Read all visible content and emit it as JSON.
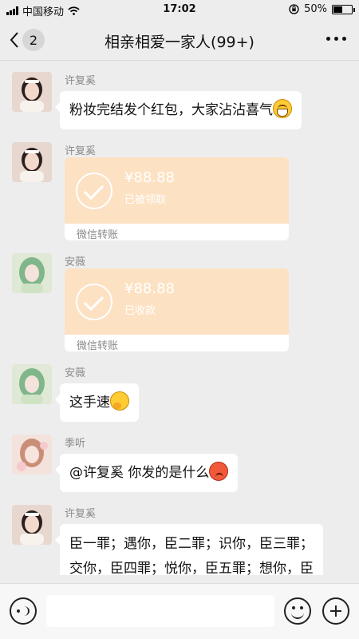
{
  "status_bar": {
    "carrier": "中国移动",
    "time": "17:02",
    "battery_percent": "50%",
    "battery_level": 0.5,
    "icons": [
      "signal-icon",
      "wifi-icon",
      "orientation-lock-icon",
      "battery-icon"
    ]
  },
  "header": {
    "back_count": "2",
    "title": "相亲相爱一家人(99+)",
    "icons": [
      "chevron-left-icon",
      "more-icon"
    ]
  },
  "messages": [
    {
      "sender": "许复奚",
      "text": "粉妆完结发个红包，大家沾沾喜气",
      "emoji": "grin-emoji"
    },
    {
      "sender": "许复奚",
      "type": "transfer",
      "amount": "¥88.88",
      "status": "已被领取",
      "label": "微信转账"
    },
    {
      "sender": "安薇",
      "type": "transfer",
      "amount": "¥88.88",
      "status": "已收款",
      "label": "微信转账"
    },
    {
      "sender": "安薇",
      "text": "这手速",
      "emoji": "thinking-emoji"
    },
    {
      "sender": "季听",
      "text": "@许复奚 你发的是什么",
      "emoji": "angry-emoji"
    },
    {
      "sender": "许复奚",
      "text": "臣一罪；遇你，臣二罪；识你，臣三罪；交你，臣四罪；悦你，臣五罪；想你，臣六罪；顾你，臣七罪；守你，臣八罪；护"
    }
  ],
  "colors": {
    "background": "#ededed",
    "bubble": "#ffffff",
    "transfer_card": "#fde1c3"
  },
  "input_bar": {
    "placeholder": "",
    "icons": [
      "voice-icon",
      "emoji-icon",
      "plus-icon"
    ]
  }
}
